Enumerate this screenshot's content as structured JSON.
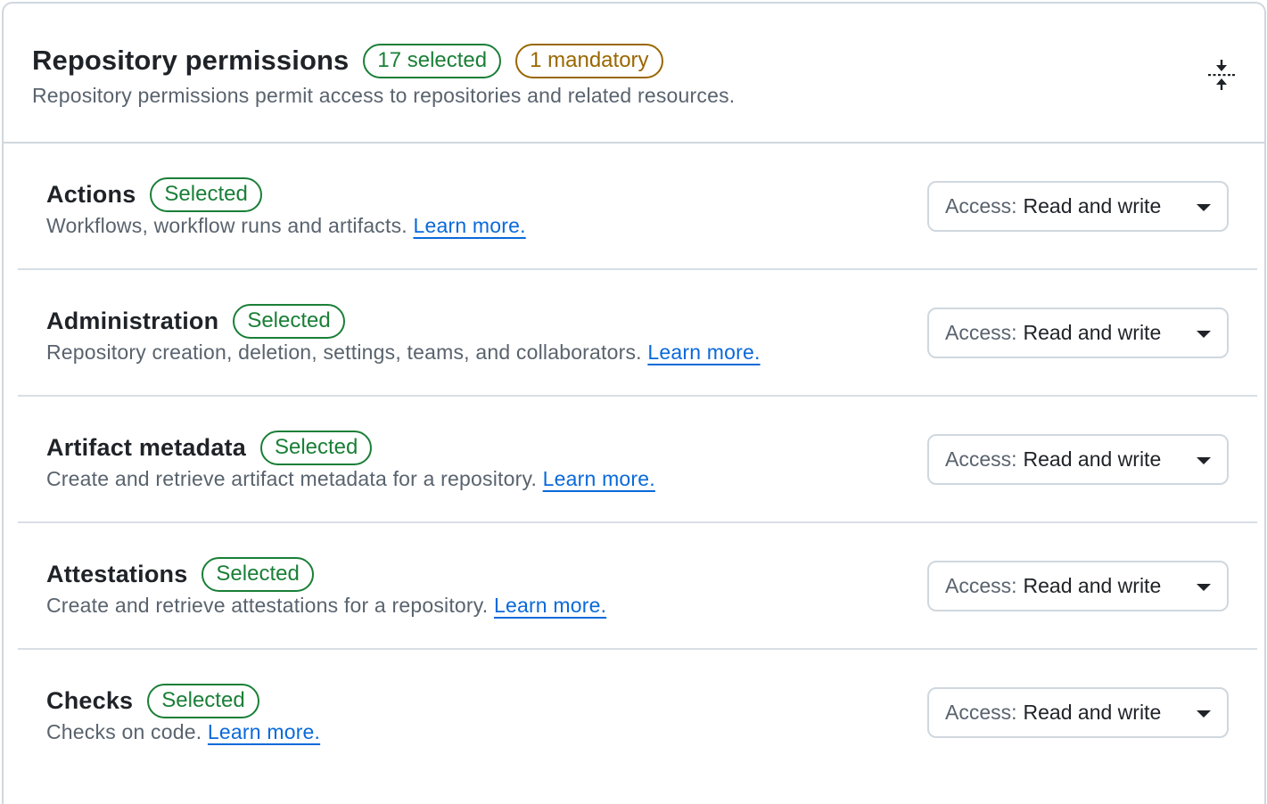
{
  "header": {
    "title": "Repository permissions",
    "selected_badge": "17 selected",
    "mandatory_badge": "1 mandatory",
    "description": "Repository permissions permit access to repositories and related resources.",
    "collapse_icon": "fold-icon"
  },
  "colors": {
    "selected_green": "#1a7f37",
    "mandatory_amber": "#9a6700",
    "link_blue": "#0969da",
    "border": "#d0d7de",
    "muted_text": "#59636e"
  },
  "permissions": [
    {
      "name": "Actions",
      "badge": "Selected",
      "description": "Workflows, workflow runs and artifacts.",
      "link": "Learn more.",
      "access_label": "Access:",
      "access_value": "Read and write"
    },
    {
      "name": "Administration",
      "badge": "Selected",
      "description": "Repository creation, deletion, settings, teams, and collaborators.",
      "link": "Learn more.",
      "access_label": "Access:",
      "access_value": "Read and write"
    },
    {
      "name": "Artifact metadata",
      "badge": "Selected",
      "description": "Create and retrieve artifact metadata for a repository.",
      "link": "Learn more.",
      "access_label": "Access:",
      "access_value": "Read and write"
    },
    {
      "name": "Attestations",
      "badge": "Selected",
      "description": "Create and retrieve attestations for a repository.",
      "link": "Learn more.",
      "access_label": "Access:",
      "access_value": "Read and write"
    },
    {
      "name": "Checks",
      "badge": "Selected",
      "description": "Checks on code.",
      "link": "Learn more.",
      "access_label": "Access:",
      "access_value": "Read and write"
    }
  ]
}
